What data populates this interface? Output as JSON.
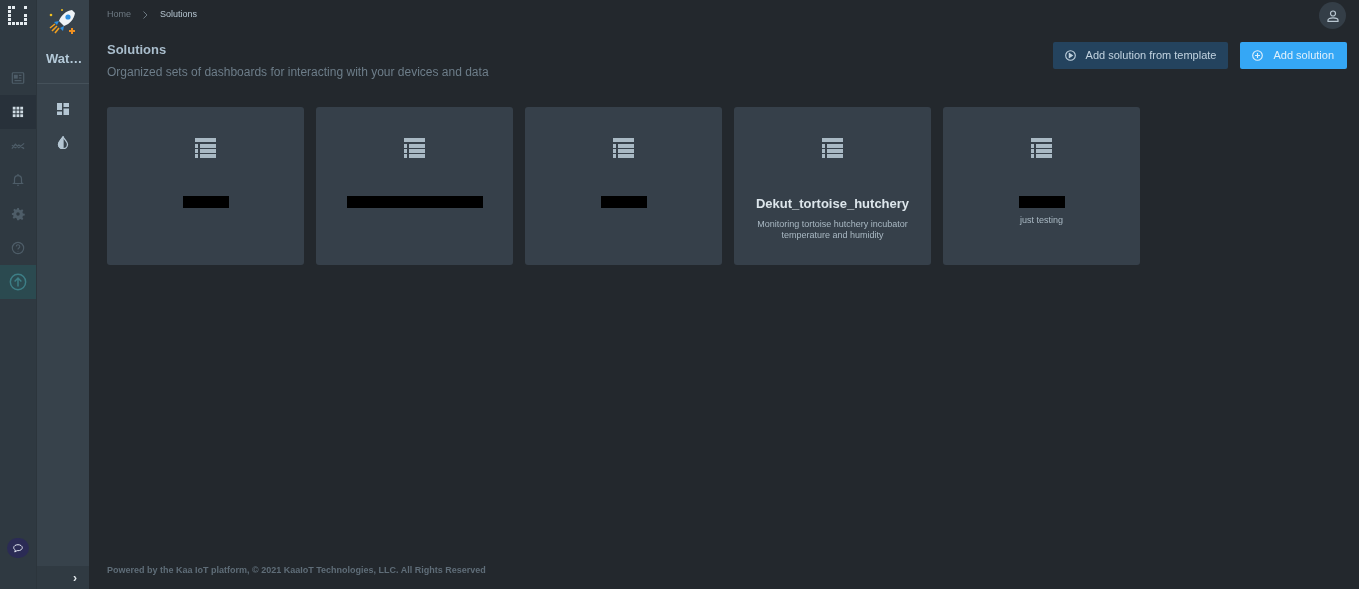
{
  "rail": {
    "items": [
      {
        "kind": "dashboard",
        "selected": false
      },
      {
        "kind": "apps",
        "selected": true
      },
      {
        "kind": "analytics",
        "selected": false
      },
      {
        "kind": "alerts",
        "selected": false
      },
      {
        "kind": "settings",
        "selected": false
      },
      {
        "kind": "help",
        "selected": false
      },
      {
        "kind": "upgrade",
        "selected": false
      }
    ]
  },
  "sidebar": {
    "app_name": "Wat…",
    "items": [
      {
        "kind": "dashboards"
      },
      {
        "kind": "contrast"
      }
    ],
    "collapse_label": "›"
  },
  "breadcrumb": [
    "Home",
    "Solutions"
  ],
  "page": {
    "title": "Solutions",
    "subtitle": "Organized sets of dashboards for interacting with your devices and data"
  },
  "actions": [
    {
      "label": "Add solution from template",
      "kind": "secondary"
    },
    {
      "label": "Add solution",
      "kind": "primary"
    }
  ],
  "solutions": [
    {
      "redacted": true
    },
    {
      "redacted": true
    },
    {
      "redacted": true
    },
    {
      "redacted": false,
      "title": "Dekut_tortoise_hutchery",
      "description": "Monitoring tortoise hutchery incubator temperature and humidity"
    },
    {
      "redacted": true,
      "description": "just testing"
    }
  ],
  "footer": "Powered by the Kaa IoT platform, © 2021 KaaIoT Technologies, LLC. All Rights Reserved"
}
